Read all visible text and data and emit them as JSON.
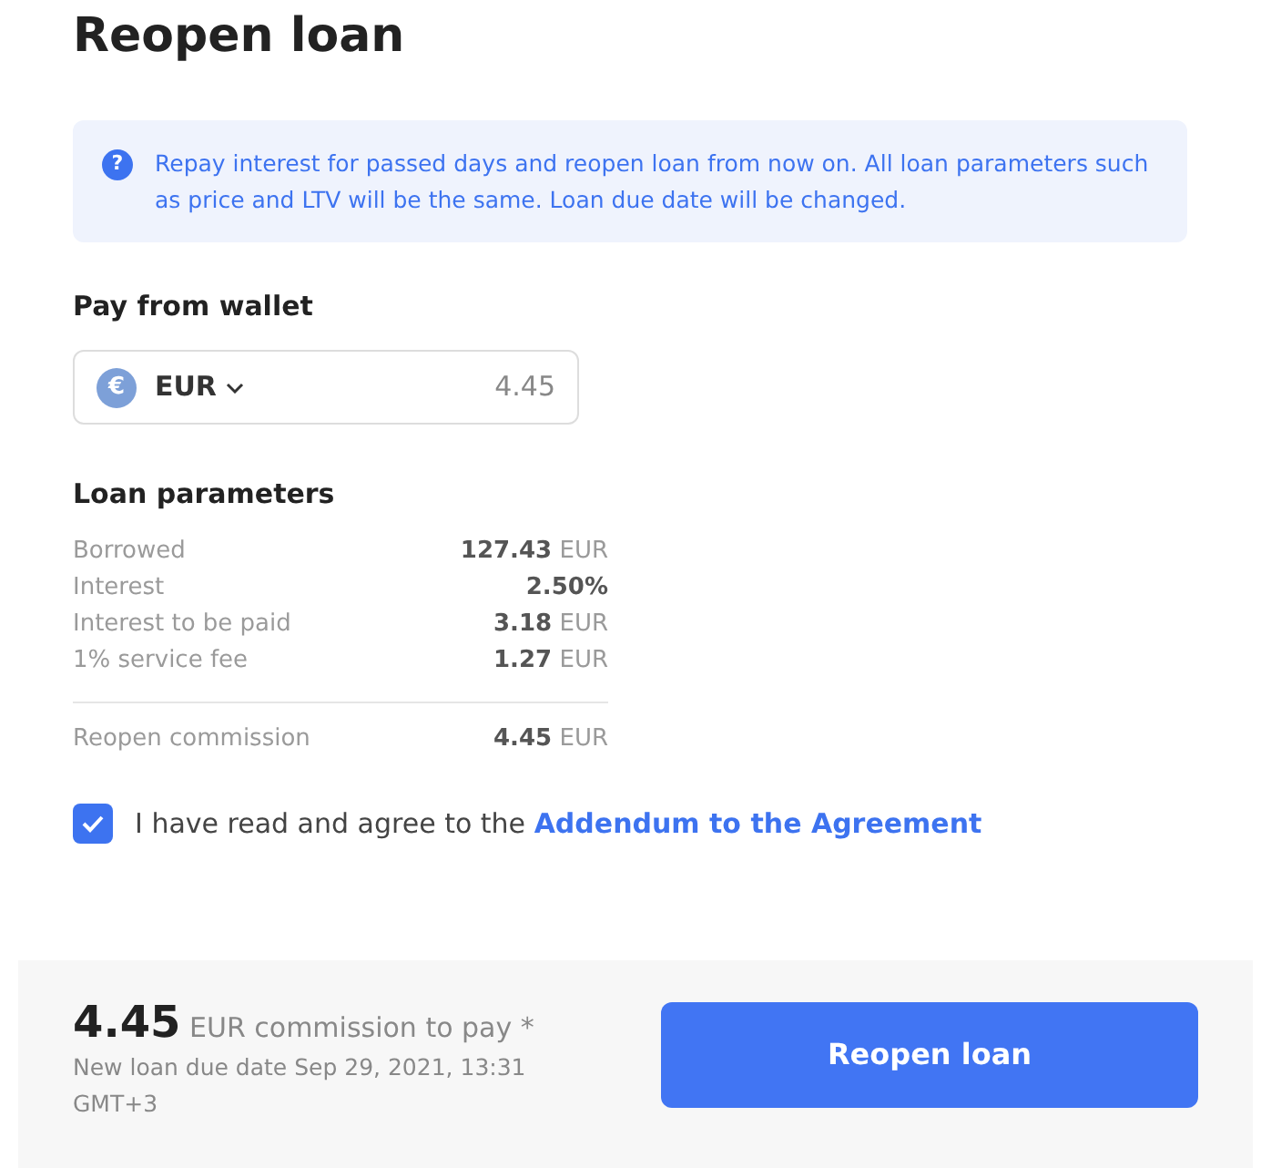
{
  "title": "Reopen loan",
  "info": {
    "icon": "?",
    "text": "Repay interest for passed days and reopen loan from now on. All loan parameters such as price and LTV will be the same. Loan due date will be changed."
  },
  "wallet": {
    "label": "Pay from wallet",
    "currency_symbol": "€",
    "currency": "EUR",
    "amount": "4.45"
  },
  "loan_parameters": {
    "title": "Loan parameters",
    "rows": [
      {
        "label": "Borrowed",
        "value": "127.43",
        "unit": "EUR"
      },
      {
        "label": "Interest",
        "value": "2.50%"
      },
      {
        "label": "Interest to be paid",
        "value": "3.18",
        "unit": "EUR"
      },
      {
        "label": "1% service fee",
        "value": "1.27",
        "unit": "EUR"
      }
    ],
    "total": {
      "label": "Reopen commission",
      "value": "4.45",
      "unit": "EUR"
    }
  },
  "agreement": {
    "checked": true,
    "text": "I have read and agree to the",
    "link": "Addendum to the Agreement"
  },
  "footer": {
    "amount": "4.45",
    "amount_caption": "EUR commission to pay *",
    "due_date": "New loan due date Sep 29, 2021, 13:31 GMT+3",
    "button": "Reopen loan"
  }
}
